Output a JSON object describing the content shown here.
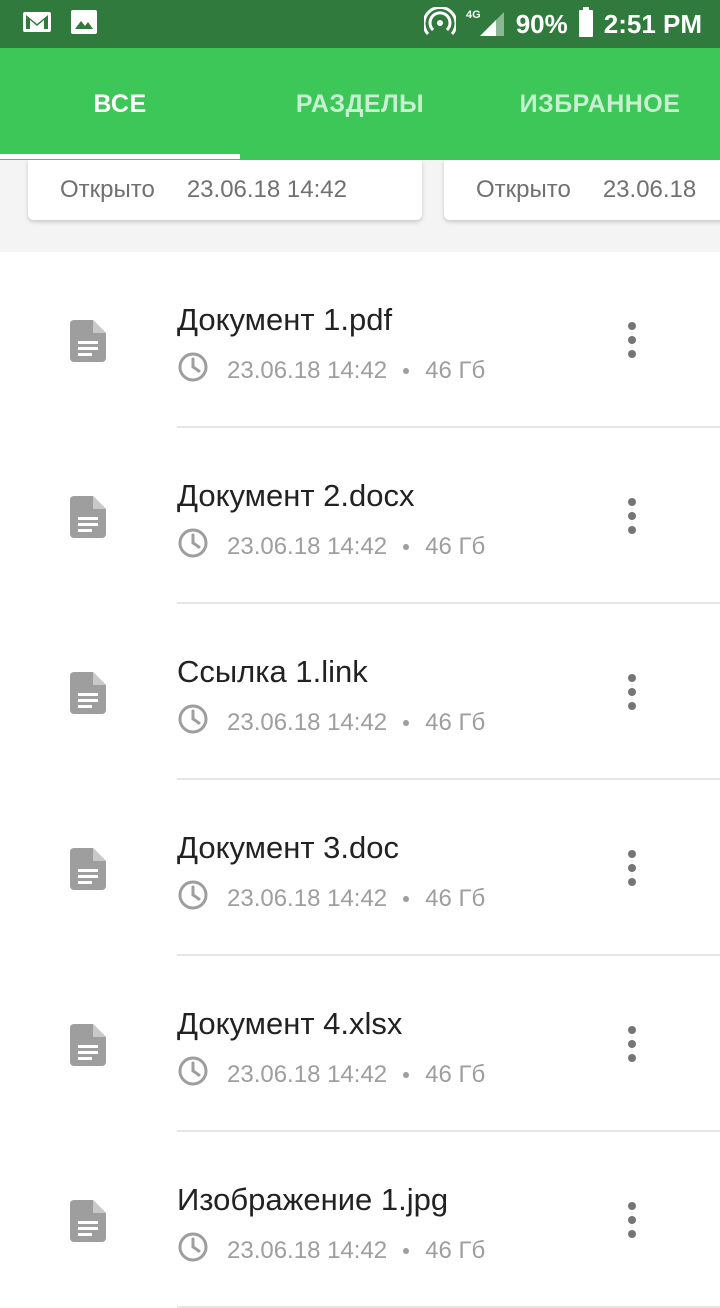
{
  "status_bar": {
    "left_icons": [
      "gmail-icon",
      "image-icon"
    ],
    "network": "4G",
    "battery": "90%",
    "time": "2:51 PM"
  },
  "tabs": [
    {
      "label": "ВСЕ",
      "active": true
    },
    {
      "label": "РАЗДЕЛЫ",
      "active": false
    },
    {
      "label": "ИЗБРАННОЕ",
      "active": false
    }
  ],
  "recent_cards": [
    {
      "label": "Открыто",
      "datetime": "23.06.18 14:42"
    },
    {
      "label": "Открыто",
      "datetime": "23.06.18"
    }
  ],
  "files": [
    {
      "name": "Документ 1.pdf",
      "date": "23.06.18 14:42",
      "size": "46 Гб"
    },
    {
      "name": "Документ 2.docx",
      "date": "23.06.18 14:42",
      "size": "46 Гб"
    },
    {
      "name": "Ссылка 1.link",
      "date": "23.06.18 14:42",
      "size": "46 Гб"
    },
    {
      "name": "Документ 3.doc",
      "date": "23.06.18 14:42",
      "size": "46 Гб"
    },
    {
      "name": "Документ 4.xlsx",
      "date": "23.06.18 14:42",
      "size": "46 Гб"
    },
    {
      "name": "Изображение 1.jpg",
      "date": "23.06.18 14:42",
      "size": "46 Гб"
    }
  ],
  "colors": {
    "status_bar": "#2f7a3c",
    "accent": "#3dc759",
    "text_primary": "#222222",
    "text_secondary": "#9e9e9e"
  }
}
